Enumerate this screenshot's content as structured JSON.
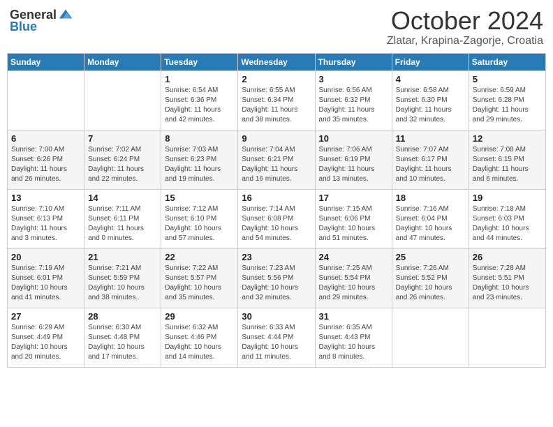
{
  "header": {
    "logo_general": "General",
    "logo_blue": "Blue",
    "month": "October 2024",
    "location": "Zlatar, Krapina-Zagorje, Croatia"
  },
  "days_of_week": [
    "Sunday",
    "Monday",
    "Tuesday",
    "Wednesday",
    "Thursday",
    "Friday",
    "Saturday"
  ],
  "weeks": [
    [
      {
        "day": "",
        "sunrise": "",
        "sunset": "",
        "daylight": ""
      },
      {
        "day": "",
        "sunrise": "",
        "sunset": "",
        "daylight": ""
      },
      {
        "day": "1",
        "sunrise": "Sunrise: 6:54 AM",
        "sunset": "Sunset: 6:36 PM",
        "daylight": "Daylight: 11 hours and 42 minutes."
      },
      {
        "day": "2",
        "sunrise": "Sunrise: 6:55 AM",
        "sunset": "Sunset: 6:34 PM",
        "daylight": "Daylight: 11 hours and 38 minutes."
      },
      {
        "day": "3",
        "sunrise": "Sunrise: 6:56 AM",
        "sunset": "Sunset: 6:32 PM",
        "daylight": "Daylight: 11 hours and 35 minutes."
      },
      {
        "day": "4",
        "sunrise": "Sunrise: 6:58 AM",
        "sunset": "Sunset: 6:30 PM",
        "daylight": "Daylight: 11 hours and 32 minutes."
      },
      {
        "day": "5",
        "sunrise": "Sunrise: 6:59 AM",
        "sunset": "Sunset: 6:28 PM",
        "daylight": "Daylight: 11 hours and 29 minutes."
      }
    ],
    [
      {
        "day": "6",
        "sunrise": "Sunrise: 7:00 AM",
        "sunset": "Sunset: 6:26 PM",
        "daylight": "Daylight: 11 hours and 26 minutes."
      },
      {
        "day": "7",
        "sunrise": "Sunrise: 7:02 AM",
        "sunset": "Sunset: 6:24 PM",
        "daylight": "Daylight: 11 hours and 22 minutes."
      },
      {
        "day": "8",
        "sunrise": "Sunrise: 7:03 AM",
        "sunset": "Sunset: 6:23 PM",
        "daylight": "Daylight: 11 hours and 19 minutes."
      },
      {
        "day": "9",
        "sunrise": "Sunrise: 7:04 AM",
        "sunset": "Sunset: 6:21 PM",
        "daylight": "Daylight: 11 hours and 16 minutes."
      },
      {
        "day": "10",
        "sunrise": "Sunrise: 7:06 AM",
        "sunset": "Sunset: 6:19 PM",
        "daylight": "Daylight: 11 hours and 13 minutes."
      },
      {
        "day": "11",
        "sunrise": "Sunrise: 7:07 AM",
        "sunset": "Sunset: 6:17 PM",
        "daylight": "Daylight: 11 hours and 10 minutes."
      },
      {
        "day": "12",
        "sunrise": "Sunrise: 7:08 AM",
        "sunset": "Sunset: 6:15 PM",
        "daylight": "Daylight: 11 hours and 6 minutes."
      }
    ],
    [
      {
        "day": "13",
        "sunrise": "Sunrise: 7:10 AM",
        "sunset": "Sunset: 6:13 PM",
        "daylight": "Daylight: 11 hours and 3 minutes."
      },
      {
        "day": "14",
        "sunrise": "Sunrise: 7:11 AM",
        "sunset": "Sunset: 6:11 PM",
        "daylight": "Daylight: 11 hours and 0 minutes."
      },
      {
        "day": "15",
        "sunrise": "Sunrise: 7:12 AM",
        "sunset": "Sunset: 6:10 PM",
        "daylight": "Daylight: 10 hours and 57 minutes."
      },
      {
        "day": "16",
        "sunrise": "Sunrise: 7:14 AM",
        "sunset": "Sunset: 6:08 PM",
        "daylight": "Daylight: 10 hours and 54 minutes."
      },
      {
        "day": "17",
        "sunrise": "Sunrise: 7:15 AM",
        "sunset": "Sunset: 6:06 PM",
        "daylight": "Daylight: 10 hours and 51 minutes."
      },
      {
        "day": "18",
        "sunrise": "Sunrise: 7:16 AM",
        "sunset": "Sunset: 6:04 PM",
        "daylight": "Daylight: 10 hours and 47 minutes."
      },
      {
        "day": "19",
        "sunrise": "Sunrise: 7:18 AM",
        "sunset": "Sunset: 6:03 PM",
        "daylight": "Daylight: 10 hours and 44 minutes."
      }
    ],
    [
      {
        "day": "20",
        "sunrise": "Sunrise: 7:19 AM",
        "sunset": "Sunset: 6:01 PM",
        "daylight": "Daylight: 10 hours and 41 minutes."
      },
      {
        "day": "21",
        "sunrise": "Sunrise: 7:21 AM",
        "sunset": "Sunset: 5:59 PM",
        "daylight": "Daylight: 10 hours and 38 minutes."
      },
      {
        "day": "22",
        "sunrise": "Sunrise: 7:22 AM",
        "sunset": "Sunset: 5:57 PM",
        "daylight": "Daylight: 10 hours and 35 minutes."
      },
      {
        "day": "23",
        "sunrise": "Sunrise: 7:23 AM",
        "sunset": "Sunset: 5:56 PM",
        "daylight": "Daylight: 10 hours and 32 minutes."
      },
      {
        "day": "24",
        "sunrise": "Sunrise: 7:25 AM",
        "sunset": "Sunset: 5:54 PM",
        "daylight": "Daylight: 10 hours and 29 minutes."
      },
      {
        "day": "25",
        "sunrise": "Sunrise: 7:26 AM",
        "sunset": "Sunset: 5:52 PM",
        "daylight": "Daylight: 10 hours and 26 minutes."
      },
      {
        "day": "26",
        "sunrise": "Sunrise: 7:28 AM",
        "sunset": "Sunset: 5:51 PM",
        "daylight": "Daylight: 10 hours and 23 minutes."
      }
    ],
    [
      {
        "day": "27",
        "sunrise": "Sunrise: 6:29 AM",
        "sunset": "Sunset: 4:49 PM",
        "daylight": "Daylight: 10 hours and 20 minutes."
      },
      {
        "day": "28",
        "sunrise": "Sunrise: 6:30 AM",
        "sunset": "Sunset: 4:48 PM",
        "daylight": "Daylight: 10 hours and 17 minutes."
      },
      {
        "day": "29",
        "sunrise": "Sunrise: 6:32 AM",
        "sunset": "Sunset: 4:46 PM",
        "daylight": "Daylight: 10 hours and 14 minutes."
      },
      {
        "day": "30",
        "sunrise": "Sunrise: 6:33 AM",
        "sunset": "Sunset: 4:44 PM",
        "daylight": "Daylight: 10 hours and 11 minutes."
      },
      {
        "day": "31",
        "sunrise": "Sunrise: 6:35 AM",
        "sunset": "Sunset: 4:43 PM",
        "daylight": "Daylight: 10 hours and 8 minutes."
      },
      {
        "day": "",
        "sunrise": "",
        "sunset": "",
        "daylight": ""
      },
      {
        "day": "",
        "sunrise": "",
        "sunset": "",
        "daylight": ""
      }
    ]
  ]
}
